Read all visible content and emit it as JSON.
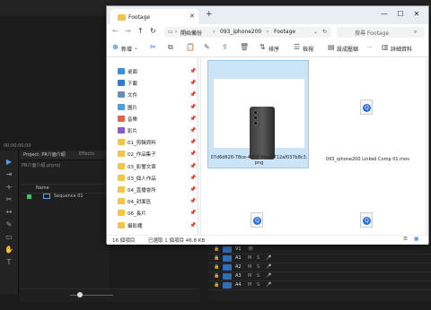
{
  "premiere": {
    "timecode": "00;00;00;00",
    "project_tab": "Project: PR介面介紹",
    "effects_tab": "Effects",
    "project_file": "PR介面介紹.prproj",
    "name_header": "Name",
    "sequence_name": "Sequence 01",
    "sequence_color": "#3fbf6a",
    "tracks": [
      "V1",
      "A1",
      "A2",
      "A3",
      "A4"
    ]
  },
  "explorer": {
    "tab_title": "Footage",
    "breadcrumb": [
      "開始備份",
      "093_iphone200",
      "Footage"
    ],
    "search_placeholder": "搜尋 Footage",
    "toolbar": {
      "new_label": "新增",
      "sort_label": "排序",
      "view_label": "檢視",
      "compress_label": "設成壓縮",
      "details_label": "詳細資料"
    },
    "sidebar": [
      {
        "label": "桌面",
        "icon": "desktop-icon",
        "color": "#3b8ee0"
      },
      {
        "label": "下載",
        "icon": "download-icon",
        "color": "#2c7cd3"
      },
      {
        "label": "文件",
        "icon": "documents-icon",
        "color": "#6a8fb5"
      },
      {
        "label": "圖片",
        "icon": "pictures-icon",
        "color": "#4aa0e0"
      },
      {
        "label": "音樂",
        "icon": "music-icon",
        "color": "#e0664a"
      },
      {
        "label": "影片",
        "icon": "videos-icon",
        "color": "#8a5ad0"
      },
      {
        "label": "01_剪輯資料",
        "icon": "folder-icon",
        "color": "#f4c542"
      },
      {
        "label": "02_作品集子",
        "icon": "folder-icon",
        "color": "#f4c542"
      },
      {
        "label": "03_影響文章",
        "icon": "folder-icon",
        "color": "#f4c542"
      },
      {
        "label": "03_個人作品",
        "icon": "folder-icon",
        "color": "#f4c542"
      },
      {
        "label": "04_直播會所",
        "icon": "folder-icon",
        "color": "#f4c542"
      },
      {
        "label": "04_封面區",
        "icon": "folder-icon",
        "color": "#f4c542"
      },
      {
        "label": "06_長片",
        "icon": "folder-icon",
        "color": "#f4c542"
      },
      {
        "label": "攝影棚",
        "icon": "folder-icon",
        "color": "#f4c542"
      }
    ],
    "files": [
      {
        "name": "07d6d626-78ce-4e56-9ba0-712af037b8c3.png",
        "selected": true,
        "kind": "image"
      },
      {
        "name": "093_iphone200 Linked Comp 01.mov",
        "selected": false,
        "kind": "video"
      },
      {
        "name": "",
        "selected": false,
        "kind": "video"
      },
      {
        "name": "",
        "selected": false,
        "kind": "video"
      }
    ],
    "status": {
      "count": "16 個項目",
      "selection": "已選取 1 個項目 46.8 KB"
    }
  }
}
